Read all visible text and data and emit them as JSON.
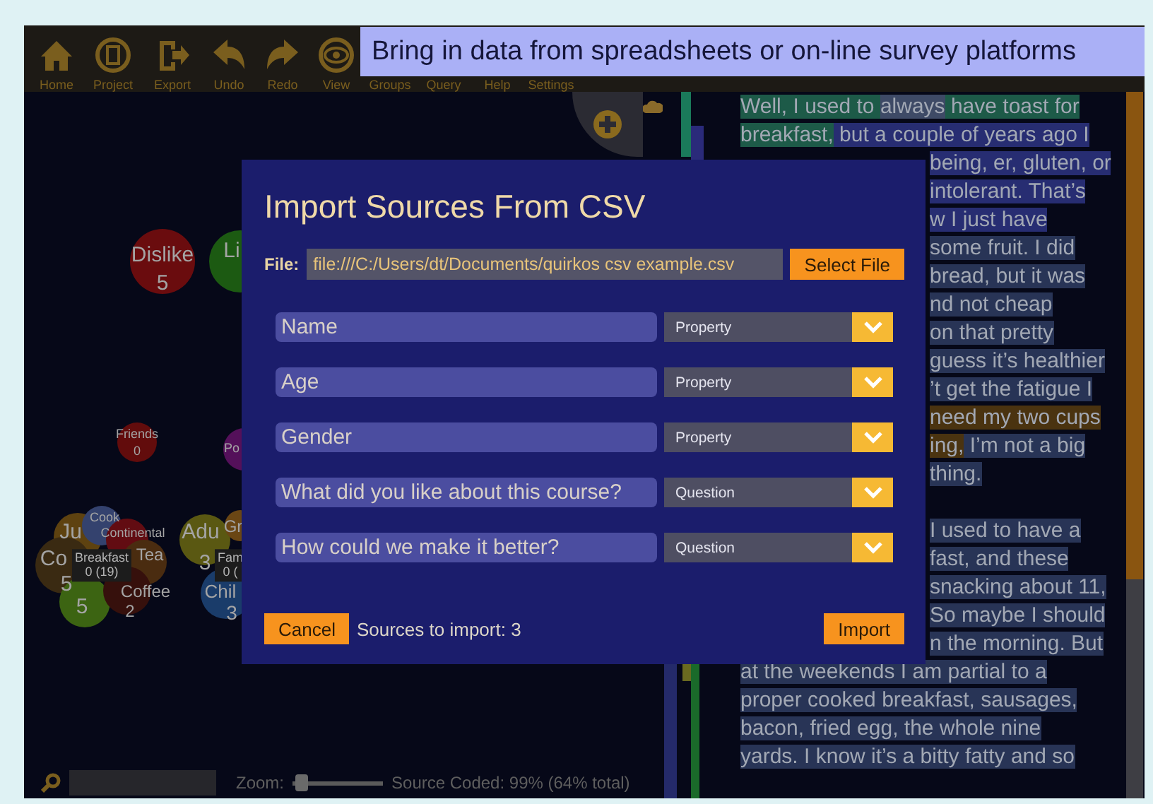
{
  "caption": "Bring in data from spreadsheets or on-line survey platforms",
  "toolbar": {
    "buttons": [
      {
        "label": "Home",
        "kind": "home"
      },
      {
        "label": "Project",
        "kind": "project"
      },
      {
        "label": "Export",
        "kind": "export"
      },
      {
        "label": "Undo",
        "kind": "undo"
      },
      {
        "label": "Redo",
        "kind": "redo"
      },
      {
        "label": "View",
        "kind": "view"
      },
      {
        "label": "Groups",
        "kind": "covered"
      },
      {
        "label": "Query",
        "kind": "covered"
      },
      {
        "label": "Help",
        "kind": "covered"
      },
      {
        "label": "Settings",
        "kind": "covered"
      }
    ]
  },
  "canvas": {
    "bubbles": [
      {
        "kind": "bubble",
        "label": "Dislike",
        "count": "5",
        "color": "#6a0c0e"
      },
      {
        "kind": "bubble",
        "label": "Li",
        "color": "#1c5a12"
      },
      {
        "kind": "bubble",
        "label": "Friends",
        "count": "0",
        "color": "#620c0c"
      },
      {
        "kind": "bubble",
        "label": "Po",
        "color": "#54105a"
      },
      {
        "kind": "bubble",
        "label": "Ju",
        "color": "#5e4210"
      },
      {
        "kind": "bubble",
        "label": "Cook",
        "color": "#34426e"
      },
      {
        "kind": "bubble",
        "label": "Continental",
        "color": "#620c12"
      },
      {
        "kind": "bubble",
        "label": "Adu",
        "count": "3",
        "color": "#5a5812"
      },
      {
        "kind": "bubble",
        "label": "Gr",
        "color": "#6a4614"
      },
      {
        "kind": "bubble",
        "label": "Co",
        "count": "5",
        "color": "#3a2a12"
      },
      {
        "kind": "box",
        "label": "Breakfast",
        "count": "0 (19)",
        "color": "#1c1c1c"
      },
      {
        "kind": "bubble",
        "label": "Tea",
        "color": "#4a2c10"
      },
      {
        "kind": "box",
        "label": "Fam",
        "count": "0 (",
        "color": "#1c1c1c"
      },
      {
        "kind": "bubble",
        "count": "5",
        "color": "#3c6412"
      },
      {
        "kind": "bubble",
        "label": "Coffee",
        "count": "2",
        "color": "#36100c"
      },
      {
        "kind": "bubble",
        "label": "Chil",
        "count": "3",
        "color": "#1a3c6a"
      }
    ]
  },
  "status_bar": {
    "zoom_label": "Zoom:",
    "zoom": {
      "level": 0.04
    },
    "coded": "Source Coded: 99% (64% total)"
  },
  "transcript": {
    "paragraphs": [
      {
        "lines": [
          {
            "clipped": false,
            "segments": [
              {
                "text": "Well, I used to ",
                "color": "#1d5a48"
              },
              {
                "text": "always",
                "color": "#3e4a66"
              },
              {
                "text": " have toast for",
                "color": "#1d5a48"
              }
            ]
          },
          {
            "clipped": false,
            "segments": [
              {
                "text": "breakfast,",
                "color": "#1d5a48"
              },
              {
                "text": " but a couple of years ago I",
                "color": "#272d72"
              }
            ]
          },
          {
            "clipped": true,
            "segments": [
              {
                "text": "being, er, gluten, or",
                "color": "#272d72"
              }
            ]
          },
          {
            "clipped": true,
            "segments": [
              {
                "text": "intolerant. That’s",
                "color": "#272d72"
              }
            ]
          },
          {
            "clipped": true,
            "segments": [
              {
                "text": "w I just have",
                "color": "#272d72"
              }
            ]
          },
          {
            "clipped": true,
            "segments": [
              {
                "text": "some fruit. I did",
                "color": "#283456"
              }
            ]
          },
          {
            "clipped": true,
            "segments": [
              {
                "text": "bread, but it was",
                "color": "#283456"
              }
            ]
          },
          {
            "clipped": true,
            "segments": [
              {
                "text": "nd not cheap",
                "color": "#283456"
              }
            ]
          },
          {
            "clipped": true,
            "segments": [
              {
                "text": "on that pretty",
                "color": "#283456"
              }
            ]
          },
          {
            "clipped": true,
            "segments": [
              {
                "text": "guess it’s healthier",
                "color": "#283456"
              }
            ]
          },
          {
            "clipped": true,
            "segments": [
              {
                "text": "’t get the fatigue I",
                "color": "#283456"
              }
            ]
          },
          {
            "clipped": true,
            "segments": [
              {
                "text": "need my two cups",
                "color": "#4a3310"
              }
            ]
          },
          {
            "clipped": true,
            "segments": [
              {
                "text": "ing,",
                "color": "#4a3310"
              },
              {
                "text": " I’m not a big",
                "color": "#283456"
              }
            ]
          },
          {
            "clipped": true,
            "segments": [
              {
                "text": "thing.",
                "color": "#283456"
              }
            ]
          }
        ]
      },
      {
        "lines": [
          {
            "clipped": true,
            "segments": [
              {
                "text": "I used to have a",
                "color": "#283456"
              }
            ]
          },
          {
            "clipped": true,
            "segments": [
              {
                "text": "fast, and these",
                "color": "#283456"
              }
            ]
          },
          {
            "clipped": true,
            "segments": [
              {
                "text": "snacking about 11,",
                "color": "#283456"
              }
            ]
          },
          {
            "clipped": true,
            "segments": [
              {
                "text": "So maybe I should",
                "color": "#283456"
              }
            ]
          },
          {
            "clipped": true,
            "segments": [
              {
                "text": "n the morning. But",
                "color": "#283456"
              }
            ]
          },
          {
            "clipped": false,
            "segments": [
              {
                "text": "at the weekends I am partial to a",
                "color": "#283456"
              }
            ]
          },
          {
            "clipped": false,
            "segments": [
              {
                "text": "proper cooked breakfast, sausages,",
                "color": "#283456"
              }
            ]
          },
          {
            "clipped": false,
            "segments": [
              {
                "text": "bacon, fried egg, the whole nine",
                "color": "#283456"
              }
            ]
          },
          {
            "clipped": false,
            "segments": [
              {
                "text": "yards. I know it’s a bitty fatty and so",
                "color": "#283456"
              }
            ]
          }
        ]
      }
    ]
  },
  "dialog": {
    "title": "Import Sources From CSV",
    "file_label": "File:",
    "file_path": "file:///C:/Users/dt/Documents/quirkos csv example.csv",
    "select_button": "Select File",
    "columns": [
      {
        "name": "Name",
        "type": "Property"
      },
      {
        "name": "Age",
        "type": "Property"
      },
      {
        "name": "Gender",
        "type": "Property"
      },
      {
        "name": "What did you like about this course?",
        "type": "Question"
      },
      {
        "name": "How could we make it better?",
        "type": "Question"
      }
    ],
    "cancel_button": "Cancel",
    "sources_count": "Sources to import: 3",
    "import_button": "Import"
  }
}
